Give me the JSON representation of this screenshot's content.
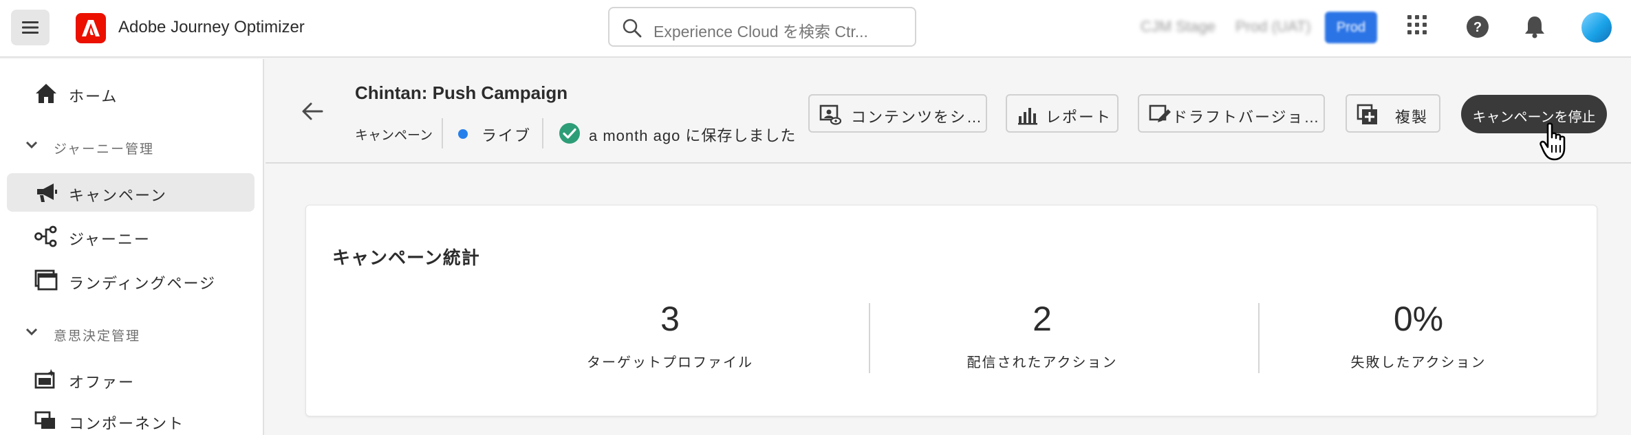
{
  "app": {
    "name": "Adobe Journey Optimizer",
    "search_placeholder": "Experience Cloud を検索 Ctr...",
    "blurred_items": [
      "CJM Stage",
      "Prod (UAT)",
      "Prod"
    ]
  },
  "sidebar": {
    "home": "ホーム",
    "sections": [
      {
        "label": "ジャーニー管理"
      },
      {
        "label": "意思決定管理"
      }
    ],
    "items": [
      {
        "label": "キャンペーン",
        "icon": "megaphone-icon",
        "active": true
      },
      {
        "label": "ジャーニー",
        "icon": "journey-icon",
        "active": false
      },
      {
        "label": "ランディングページ",
        "icon": "landing-page-icon",
        "active": false
      },
      {
        "label": "オファー",
        "icon": "offer-icon",
        "active": false
      },
      {
        "label": "コンポーネント",
        "icon": "components-icon",
        "active": false
      }
    ]
  },
  "page": {
    "title": "Chintan: Push Campaign",
    "type": "キャンペーン",
    "status": "ライブ",
    "status_color": "#2680eb",
    "saved": "a month ago に保存しました",
    "actions": [
      {
        "label": "コンテンツをシ…",
        "icon": "content-simulate-icon"
      },
      {
        "label": "レポート",
        "icon": "report-icon"
      },
      {
        "label": "ドラフトバージョ…",
        "icon": "draft-edit-icon"
      },
      {
        "label": "複製",
        "icon": "duplicate-icon"
      }
    ],
    "primary_action": "キャンペーンを停止"
  },
  "stats": {
    "title": "キャンペーン統計",
    "items": [
      {
        "value": "3",
        "label": "ターゲットプロファイル"
      },
      {
        "value": "2",
        "label": "配信されたアクション"
      },
      {
        "value": "0%",
        "label": "失敗したアクション"
      }
    ]
  },
  "colors": {
    "brand": "#eb1000",
    "accent": "#2680eb",
    "success": "#2d9d78",
    "primary_button": "#3a3a3a"
  }
}
